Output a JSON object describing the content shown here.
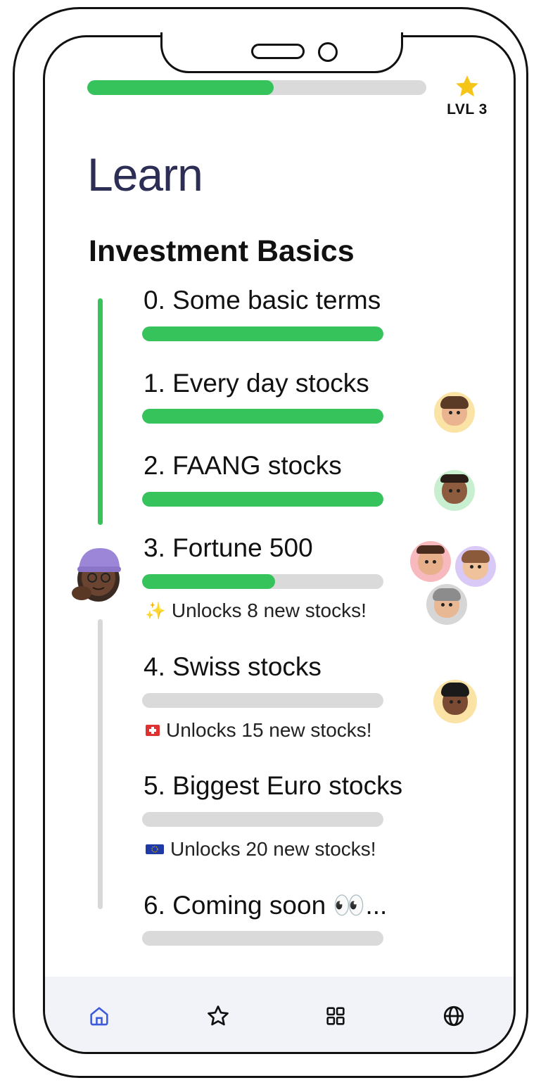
{
  "header": {
    "progress": 0.55,
    "level_label": "LVL 3",
    "star_color": "#f5c518"
  },
  "page_title": "Learn",
  "section_title": "Investment Basics",
  "lessons": [
    {
      "title": "0. Some basic terms",
      "progress": 1.0,
      "unlock": ""
    },
    {
      "title": "1. Every day stocks",
      "progress": 1.0,
      "unlock": ""
    },
    {
      "title": "2. FAANG stocks",
      "progress": 1.0,
      "unlock": ""
    },
    {
      "title": "3. Fortune 500",
      "progress": 0.55,
      "unlock": "Unlocks 8 new stocks!",
      "unlock_icon": "sparkles-icon"
    },
    {
      "title": "4. Swiss stocks",
      "progress": 0,
      "unlock": "Unlocks 15 new stocks!",
      "unlock_icon": "swiss-flag-icon"
    },
    {
      "title": "5. Biggest Euro stocks",
      "progress": 0,
      "unlock": "Unlocks 20 new stocks!",
      "unlock_icon": "eu-flag-icon"
    },
    {
      "title": "6. Coming soon 👀...",
      "progress": 0,
      "unlock": ""
    }
  ],
  "colors": {
    "accent_green": "#36c35b",
    "track_grey": "#dadada",
    "title_navy": "#2d2e55",
    "nav_active": "#3d5bd9"
  },
  "friends": [
    {
      "name": "friend-avatar-1",
      "bg": "#fbe3a6"
    },
    {
      "name": "friend-avatar-2",
      "bg": "#c8efd0"
    },
    {
      "name": "friend-avatar-3",
      "bg": "#f7b9bd"
    },
    {
      "name": "friend-avatar-4",
      "bg": "#d9c9f7"
    },
    {
      "name": "friend-avatar-5",
      "bg": "#d6d6d6"
    },
    {
      "name": "friend-avatar-6",
      "bg": "#fbe3a6"
    }
  ],
  "nav": [
    {
      "icon": "home-icon",
      "active": true
    },
    {
      "icon": "star-icon",
      "active": false
    },
    {
      "icon": "grid-icon",
      "active": false
    },
    {
      "icon": "globe-icon",
      "active": false
    }
  ]
}
